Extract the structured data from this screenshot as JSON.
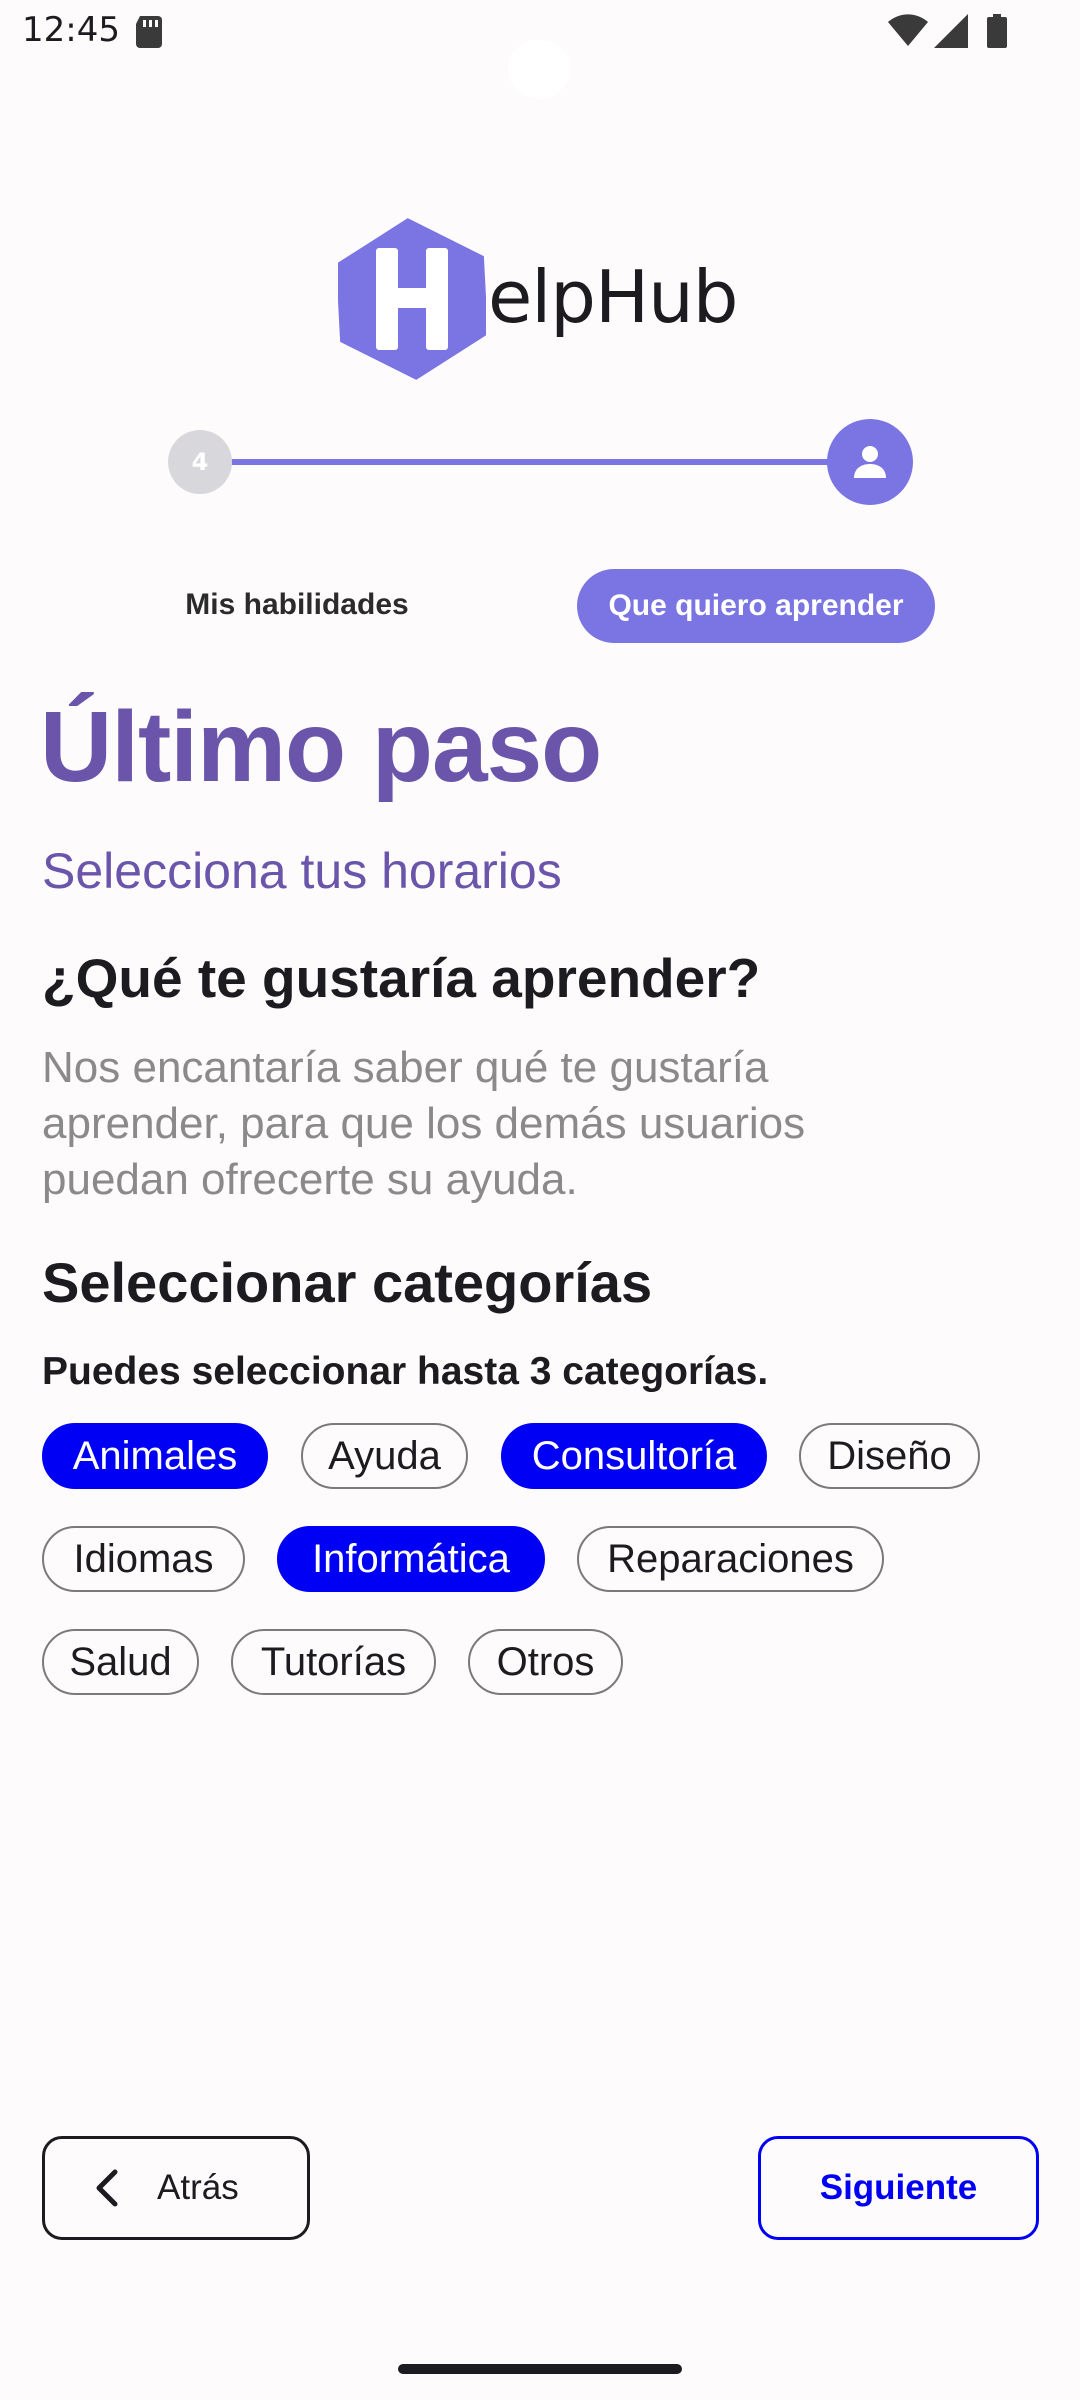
{
  "status_bar": {
    "time": "12:45",
    "icons": [
      "sd-card-icon",
      "wifi-icon",
      "cellular-signal-icon",
      "battery-icon"
    ]
  },
  "logo": {
    "mark_letter": "H",
    "text": "elpHub",
    "color": "#7b74e3"
  },
  "stepper": {
    "current_step": "4",
    "final_icon": "person-icon",
    "color": "#7b74e3"
  },
  "tabs": {
    "skills": "Mis habilidades",
    "learn": "Que quiero aprender",
    "active": "learn"
  },
  "main": {
    "title": "Último paso",
    "subtitle": "Selecciona tus horarios",
    "question": "¿Qué te gustaría aprender?",
    "description": "Nos encantaría saber qué te gustaría aprender, para que los demás usuarios puedan ofrecerte su ayuda.",
    "categories_title": "Seleccionar categorías",
    "categories_hint": "Puedes seleccionar hasta 3 categorías."
  },
  "categories": [
    {
      "label": "Animales",
      "selected": true
    },
    {
      "label": "Ayuda",
      "selected": false
    },
    {
      "label": "Consultoría",
      "selected": true
    },
    {
      "label": "Diseño",
      "selected": false
    },
    {
      "label": "Idiomas",
      "selected": false
    },
    {
      "label": "Informática",
      "selected": true
    },
    {
      "label": "Reparaciones",
      "selected": false
    },
    {
      "label": "Salud",
      "selected": false
    },
    {
      "label": "Tutorías",
      "selected": false
    },
    {
      "label": "Otros",
      "selected": false
    }
  ],
  "footer": {
    "back_label": "Atrás",
    "next_label": "Siguiente"
  },
  "colors": {
    "primary": "#7b74e3",
    "heading": "#6a55ab",
    "selected_chip": "#0000f5"
  }
}
